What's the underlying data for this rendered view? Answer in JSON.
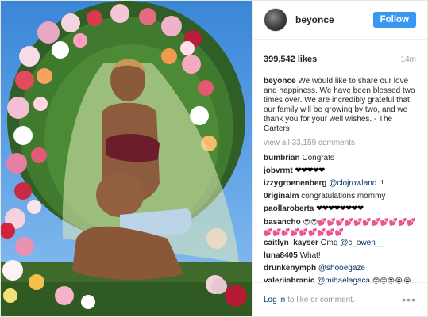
{
  "post": {
    "username": "beyonce",
    "follow_label": "Follow",
    "likes": "399,542 likes",
    "time": "14m",
    "caption_user": "beyonce",
    "caption_text": "We would like to share our love and happiness. We have been blessed two times over. We are incredibly grateful that our family will be growing by two, and we thank you for your well wishes. - The Carters",
    "view_all": "view all 33,159 comments"
  },
  "comments": [
    {
      "user": "bumbrian",
      "text": "Congrats"
    },
    {
      "user": "jobvrmt",
      "text": "❤❤❤❤❤"
    },
    {
      "user": "izzygroenenberg",
      "mention": "@clojrowland",
      "text": "!!"
    },
    {
      "user": "0riginalm",
      "text": "congratulations mommy"
    },
    {
      "user": "paollaroberta",
      "text": "❤❤❤❤❤❤❤❤"
    },
    {
      "user": "basancho",
      "text": "😍😍💕💕💕💕💕💕💕💕💕💕💕💕💕💕💕💕💕💕💕💕"
    },
    {
      "user": "caitlyn_kayser",
      "text": "Omg",
      "mention": "@c_owen__"
    },
    {
      "user": "luna8405",
      "text": "What!"
    },
    {
      "user": "drunkenymph",
      "mention": "@shooegaze"
    },
    {
      "user": "valeriiabranic",
      "mention": "@mihaelagaca",
      "text": "😊😊😍😭😭"
    }
  ],
  "footer": {
    "login_label": "Log in",
    "login_suffix": "to like or comment.",
    "more_label": "•••"
  }
}
